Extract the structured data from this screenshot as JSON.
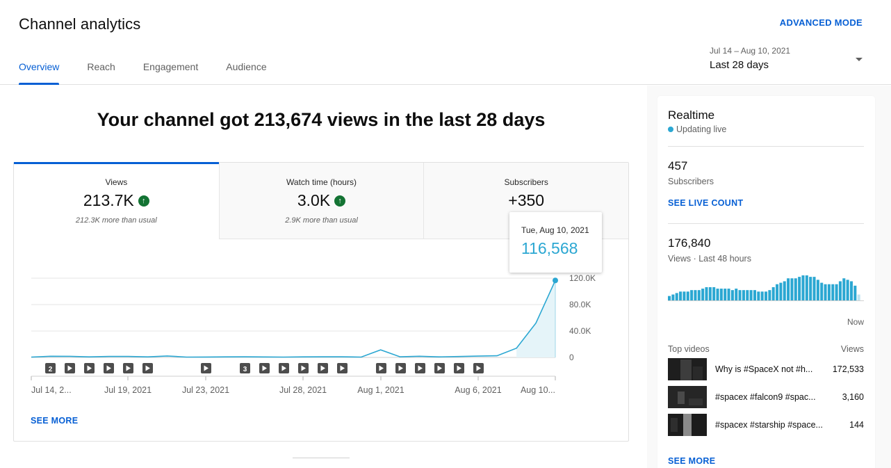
{
  "header": {
    "title": "Channel analytics",
    "advanced_mode": "ADVANCED MODE",
    "tabs": [
      {
        "label": "Overview",
        "active": true
      },
      {
        "label": "Reach",
        "active": false
      },
      {
        "label": "Engagement",
        "active": false
      },
      {
        "label": "Audience",
        "active": false
      }
    ],
    "date_range": "Jul 14 – Aug 10, 2021",
    "date_label": "Last 28 days"
  },
  "main": {
    "headline": "Your channel got 213,674 views in the last 28 days",
    "metrics": [
      {
        "label": "Views",
        "value": "213.7K",
        "sub": "212.3K more than usual",
        "trend": "up"
      },
      {
        "label": "Watch time (hours)",
        "value": "3.0K",
        "sub": "2.9K more than usual",
        "trend": "up"
      },
      {
        "label": "Subscribers",
        "value": "+350",
        "sub": "",
        "trend": ""
      }
    ],
    "see_more": "SEE MORE",
    "tooltip": {
      "date": "Tue, Aug 10, 2021",
      "value": "116,568"
    }
  },
  "chart_data": {
    "type": "line",
    "x_tick_labels": [
      "Jul 14, 2...",
      "Jul 19, 2021",
      "Jul 23, 2021",
      "Jul 28, 2021",
      "Aug 1, 2021",
      "Aug 6, 2021",
      "Aug 10..."
    ],
    "y_tick_labels": [
      "0",
      "40.0K",
      "80.0K",
      "120.0K"
    ],
    "ylim": [
      0,
      120000
    ],
    "x": [
      "Jul 14",
      "Jul 15",
      "Jul 16",
      "Jul 17",
      "Jul 18",
      "Jul 19",
      "Jul 20",
      "Jul 21",
      "Jul 22",
      "Jul 23",
      "Jul 24",
      "Jul 25",
      "Jul 26",
      "Jul 27",
      "Jul 28",
      "Jul 29",
      "Jul 30",
      "Jul 31",
      "Aug 1",
      "Aug 2",
      "Aug 3",
      "Aug 4",
      "Aug 5",
      "Aug 6",
      "Aug 7",
      "Aug 8",
      "Aug 9",
      "Aug 10"
    ],
    "values": [
      500,
      1800,
      1700,
      800,
      1500,
      1500,
      800,
      2200,
      500,
      600,
      800,
      1000,
      700,
      500,
      800,
      1000,
      1000,
      500,
      11500,
      1000,
      1800,
      800,
      1400,
      2000,
      2500,
      14000,
      52000,
      116568
    ],
    "markers": [
      {
        "label": "2"
      },
      {
        "label": ""
      },
      {
        "label": ""
      },
      {
        "label": ""
      },
      {
        "label": ""
      },
      {
        "label": ""
      },
      {
        "label": ""
      },
      {
        "label": "3"
      },
      {
        "label": ""
      },
      {
        "label": ""
      },
      {
        "label": ""
      },
      {
        "label": ""
      },
      {
        "label": ""
      },
      {
        "label": ""
      },
      {
        "label": ""
      },
      {
        "label": ""
      },
      {
        "label": ""
      },
      {
        "label": ""
      },
      {
        "label": ""
      }
    ],
    "line_color": "#2ba7d2",
    "fill_color": "#e5f4f9",
    "grid": true
  },
  "realtime": {
    "title": "Realtime",
    "status": "Updating live",
    "subscribers_value": "457",
    "subscribers_label": "Subscribers",
    "see_live_count": "SEE LIVE COUNT",
    "views_value": "176,840",
    "views_label": "Views · Last 48 hours",
    "now_label": "Now",
    "bars": [
      3,
      4,
      5,
      6,
      6,
      6,
      7,
      7,
      7,
      8,
      9,
      9,
      9,
      8,
      8,
      8,
      8,
      7,
      8,
      7,
      7,
      7,
      7,
      7,
      6,
      6,
      6,
      7,
      9,
      11,
      12,
      13,
      15,
      15,
      15,
      16,
      17,
      17,
      16,
      16,
      14,
      12,
      11,
      11,
      11,
      11,
      13,
      15,
      14,
      13,
      10,
      4
    ],
    "bar_color": "#2ba7d2",
    "top_videos_label": "Top videos",
    "views_col_label": "Views",
    "videos": [
      {
        "title": "Why is #SpaceX not #h...",
        "views": "172,533"
      },
      {
        "title": "#spacex #falcon9 #spac...",
        "views": "3,160"
      },
      {
        "title": "#spacex #starship #space...",
        "views": "144"
      }
    ],
    "see_more": "SEE MORE"
  }
}
